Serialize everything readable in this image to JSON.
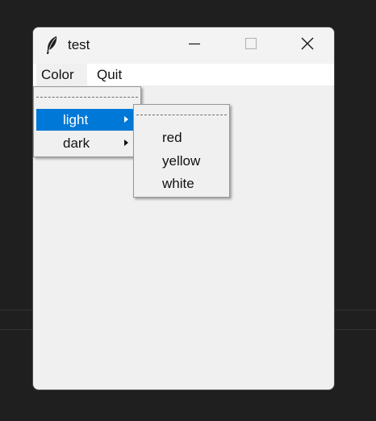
{
  "window": {
    "title": "test",
    "icon": "feather-icon",
    "controls": [
      "minimize-icon",
      "maximize-icon",
      "close-icon"
    ]
  },
  "menubar": {
    "items": [
      {
        "label": "Color"
      },
      {
        "label": "Quit"
      }
    ]
  },
  "color_menu": {
    "items": [
      {
        "label": "light",
        "active": true,
        "has_submenu": true
      },
      {
        "label": "dark",
        "active": false,
        "has_submenu": true
      }
    ]
  },
  "light_submenu": {
    "items": [
      {
        "label": "red"
      },
      {
        "label": "yellow"
      },
      {
        "label": "white"
      }
    ]
  },
  "colors": {
    "highlight": "#0078d7",
    "menu_background": "#f0f0f0",
    "desktop": "#1f1f1f"
  }
}
